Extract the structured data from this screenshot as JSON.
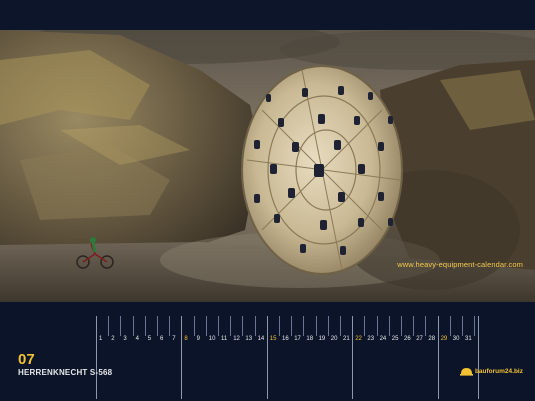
{
  "photo": {
    "website": "www.heavy-equipment-calendar.com"
  },
  "calendar": {
    "month_number": "07",
    "machine_name": "HERRENKNECHT S-568",
    "highlight_color": "#f2c233",
    "days": [
      {
        "label": "1",
        "highlight": false
      },
      {
        "label": "2",
        "highlight": false
      },
      {
        "label": "3",
        "highlight": false
      },
      {
        "label": "4",
        "highlight": false
      },
      {
        "label": "5",
        "highlight": false
      },
      {
        "label": "6",
        "highlight": false
      },
      {
        "label": "7",
        "highlight": false
      },
      {
        "label": "8",
        "highlight": true
      },
      {
        "label": "9",
        "highlight": false
      },
      {
        "label": "10",
        "highlight": false
      },
      {
        "label": "11",
        "highlight": false
      },
      {
        "label": "12",
        "highlight": false
      },
      {
        "label": "13",
        "highlight": false
      },
      {
        "label": "14",
        "highlight": false
      },
      {
        "label": "15",
        "highlight": true
      },
      {
        "label": "16",
        "highlight": false
      },
      {
        "label": "17",
        "highlight": false
      },
      {
        "label": "18",
        "highlight": false
      },
      {
        "label": "19",
        "highlight": false
      },
      {
        "label": "20",
        "highlight": false
      },
      {
        "label": "21",
        "highlight": false
      },
      {
        "label": "22",
        "highlight": true
      },
      {
        "label": "23",
        "highlight": false
      },
      {
        "label": "24",
        "highlight": false
      },
      {
        "label": "25",
        "highlight": false
      },
      {
        "label": "26",
        "highlight": false
      },
      {
        "label": "27",
        "highlight": false
      },
      {
        "label": "28",
        "highlight": false
      },
      {
        "label": "29",
        "highlight": true
      },
      {
        "label": "30",
        "highlight": false
      },
      {
        "label": "31",
        "highlight": false
      }
    ]
  },
  "logo": {
    "text": "bauforum24.biz",
    "icon": "hard-hat-icon"
  }
}
